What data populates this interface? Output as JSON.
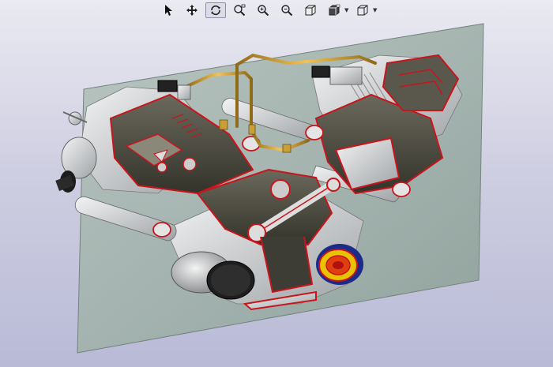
{
  "toolbar": {
    "tools": [
      {
        "icon": "select-arrow-icon"
      },
      {
        "icon": "pan-move-icon"
      },
      {
        "icon": "rotate-icon",
        "active": true
      },
      {
        "icon": "zoom-window-icon"
      },
      {
        "icon": "zoom-in-icon"
      },
      {
        "icon": "zoom-fit-icon"
      },
      {
        "icon": "solid-view-icon"
      },
      {
        "icon": "render-mode-icon",
        "dropdown": true
      },
      {
        "icon": "view-orientation-icon",
        "dropdown": true
      }
    ]
  },
  "scene": {
    "section_plane_color": "#9fb0ab",
    "cut_edge_color": "#c8151c",
    "metal_color": "#d4d6d8",
    "dark_metal_color": "#4a4940",
    "tube_color": "#d9a63a"
  }
}
